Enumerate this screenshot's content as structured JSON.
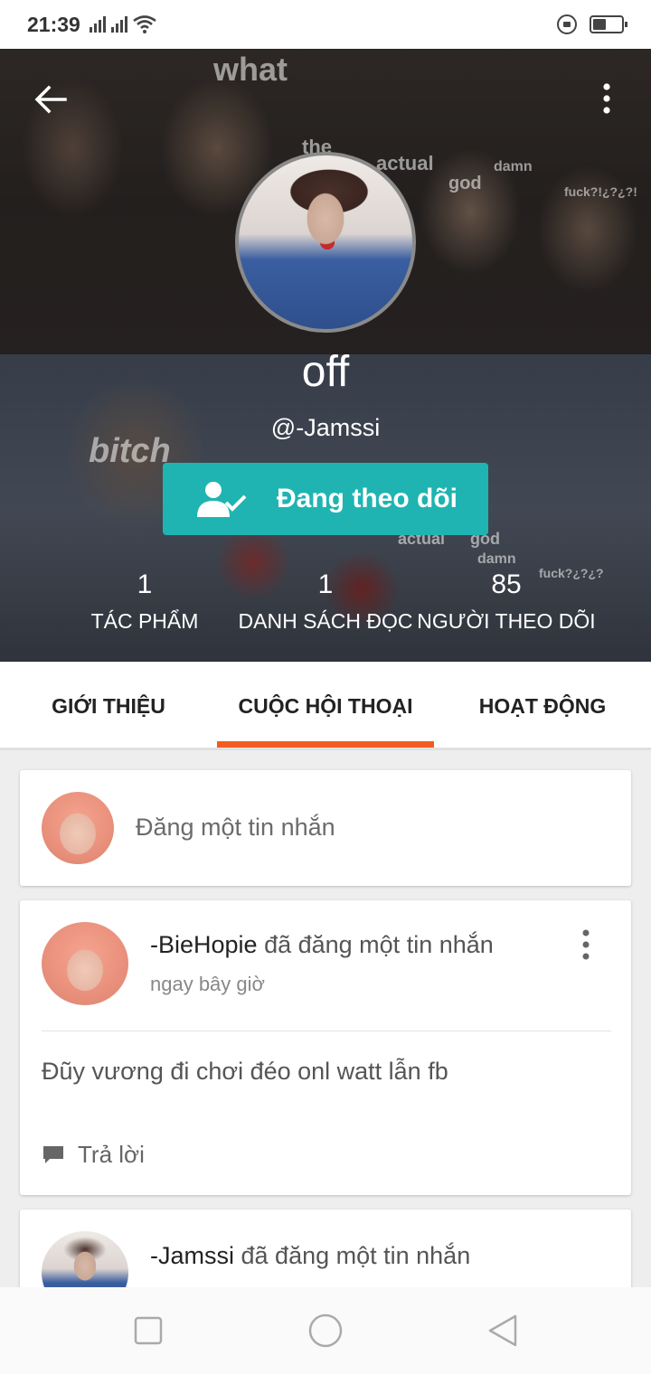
{
  "status_bar": {
    "time": "21:39",
    "icons": [
      "signal-icon",
      "signal-icon",
      "wifi-icon",
      "lock-rotation-icon",
      "battery-icon"
    ]
  },
  "header": {
    "back_icon": "arrow-left-icon",
    "more_icon": "more-vertical-icon",
    "overlay_words": [
      "what",
      "the",
      "actual",
      "god",
      "damn",
      "fuck?!¿?¿?!",
      "bitch",
      "actual",
      "god",
      "damn",
      "fuck?¿?¿?"
    ],
    "profile_name": "off",
    "handle": "@-Jamssi",
    "follow_button": {
      "label": "Đang theo dõi",
      "icon": "user-check-icon",
      "color": "#1fb4b2"
    },
    "stats": [
      {
        "value": "1",
        "label": "TÁC PHẨM"
      },
      {
        "value": "1",
        "label": "DANH SÁCH ĐỌC"
      },
      {
        "value": "85",
        "label": "NGƯỜI THEO DÕI"
      }
    ]
  },
  "tabs": {
    "items": [
      {
        "label": "GIỚI THIỆU"
      },
      {
        "label": "CUỘC HỘI THOẠI"
      },
      {
        "label": "HOẠT ĐỘNG"
      }
    ],
    "active_index": 1,
    "accent_color": "#f25c22"
  },
  "compose": {
    "placeholder": "Đăng một tin nhắn"
  },
  "messages": [
    {
      "author": "-BieHopie",
      "action": "đã đăng một tin nhắn",
      "time": "ngay bây giờ",
      "body": "Đũy vương đi chơi đéo onl watt lẫn fb",
      "reply_label": "Trả lời"
    },
    {
      "author": "-Jamssi",
      "action": "đã đăng một tin nhắn"
    }
  ],
  "nav_bar": {
    "icons": [
      "recent-apps-icon",
      "home-icon",
      "back-triangle-icon"
    ]
  }
}
